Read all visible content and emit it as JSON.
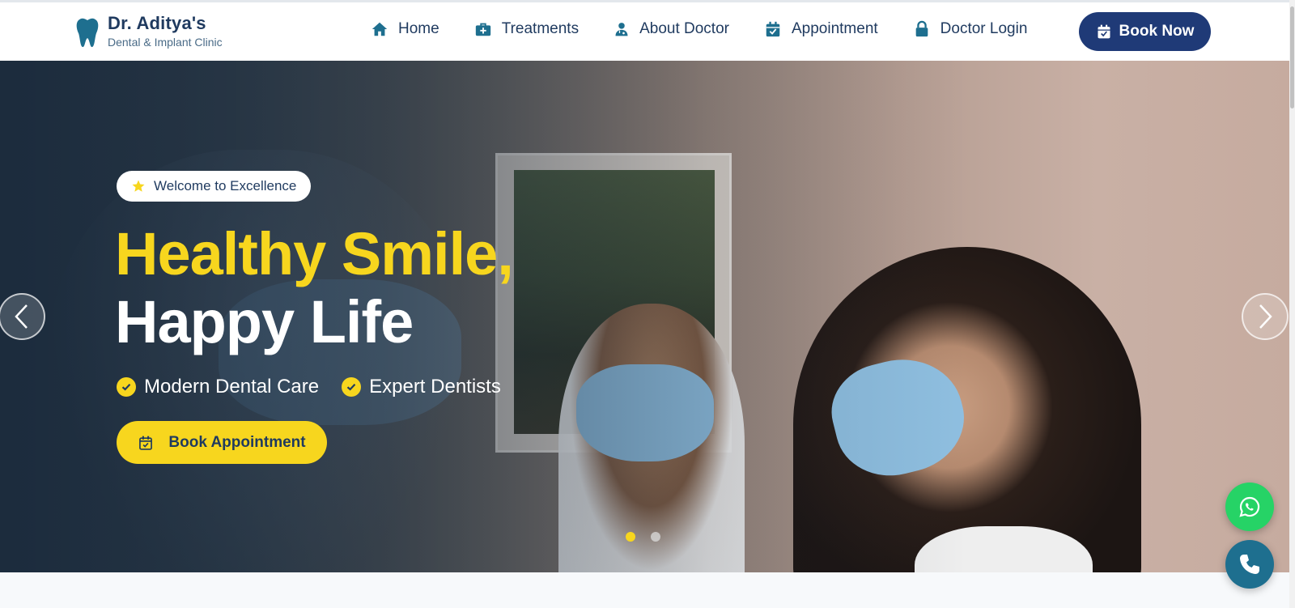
{
  "brand": {
    "name": "Dr. Aditya's",
    "subtitle": "Dental & Implant Clinic",
    "icon": "tooth-icon"
  },
  "nav": {
    "items": [
      {
        "label": "Home",
        "icon": "home-icon"
      },
      {
        "label": "Treatments",
        "icon": "medkit-icon"
      },
      {
        "label": "About Doctor",
        "icon": "doctor-icon"
      },
      {
        "label": "Appointment",
        "icon": "calendar-check-icon"
      },
      {
        "label": "Doctor Login",
        "icon": "lock-icon"
      }
    ],
    "cta_label": "Book Now"
  },
  "hero": {
    "badge": "Welcome to Excellence",
    "title_line1": "Healthy Smile,",
    "title_line2": "Happy Life",
    "features": [
      "Modern Dental Care",
      "Expert Dentists"
    ],
    "cta_label": "Book Appointment",
    "slides_total": 2,
    "active_slide": 1
  },
  "colors": {
    "accent_yellow": "#f7d61e",
    "brand_navy": "#1f3a77",
    "text_navy": "#1f3a5f",
    "icon_teal": "#1e6f8f",
    "whatsapp_green": "#26d366"
  },
  "floating": {
    "whatsapp_icon": "whatsapp-icon",
    "call_icon": "phone-icon"
  }
}
